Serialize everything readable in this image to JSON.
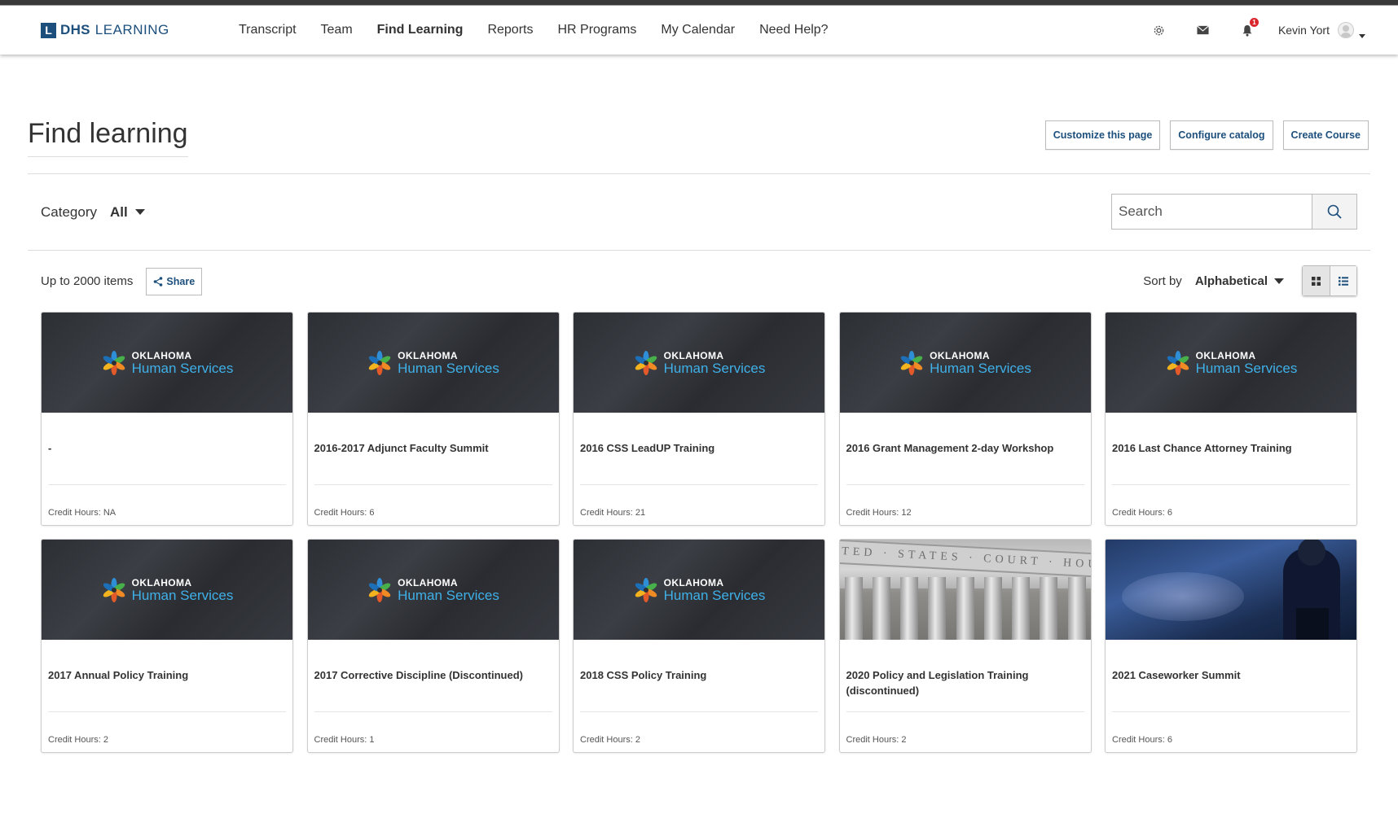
{
  "brand": {
    "strong": "DHS",
    "light": "LEARNING",
    "mark": "L"
  },
  "nav": {
    "links": [
      "Transcript",
      "Team",
      "Find Learning",
      "Reports",
      "HR Programs",
      "My Calendar",
      "Need Help?"
    ],
    "active": "Find Learning",
    "notification_count": "1",
    "user_name": "Kevin Yort"
  },
  "header": {
    "title": "Find learning",
    "buttons": [
      "Customize this page",
      "Configure catalog",
      "Create Course"
    ]
  },
  "filters": {
    "category_label": "Category",
    "category_value": "All",
    "search_placeholder": "Search"
  },
  "toolbar": {
    "count": "Up to 2000 items",
    "share": "Share",
    "sort_label": "Sort by",
    "sort_value": "Alphabetical",
    "view": "grid"
  },
  "thumbnail_brand": {
    "line1": "OKLAHOMA",
    "line2": "Human Services"
  },
  "court_frieze_text": "UNITED · STATES · COURT · HOUSE",
  "courses": [
    {
      "title": "-",
      "credit": "Credit Hours: NA",
      "image": "ok"
    },
    {
      "title": "2016-2017 Adjunct Faculty Summit",
      "credit": "Credit Hours: 6",
      "image": "ok"
    },
    {
      "title": "2016 CSS LeadUP Training",
      "credit": "Credit Hours: 21",
      "image": "ok"
    },
    {
      "title": "2016 Grant Management 2-day Workshop",
      "credit": "Credit Hours: 12",
      "image": "ok"
    },
    {
      "title": "2016 Last Chance Attorney Training",
      "credit": "Credit Hours: 6",
      "image": "ok"
    },
    {
      "title": "2017 Annual Policy Training",
      "credit": "Credit Hours: 2",
      "image": "ok"
    },
    {
      "title": "2017 Corrective Discipline (Discontinued)",
      "credit": "Credit Hours: 1",
      "image": "ok"
    },
    {
      "title": "2018 CSS Policy Training",
      "credit": "Credit Hours: 2",
      "image": "ok"
    },
    {
      "title": "2020 Policy and Legislation Training (discontinued)",
      "credit": "Credit Hours: 2",
      "image": "court"
    },
    {
      "title": "2021 Caseworker Summit",
      "credit": "Credit Hours: 6",
      "image": "conference"
    }
  ],
  "colors": {
    "brand": "#1c4f7c",
    "accent_blue": "#3fb0e8",
    "badge": "#d9252b"
  },
  "icons": {
    "settings": "gear-icon",
    "mail": "envelope-icon",
    "notifications": "bell-icon",
    "search": "search-icon",
    "share": "share-icon",
    "grid_view": "grid-icon",
    "list_view": "list-icon"
  }
}
